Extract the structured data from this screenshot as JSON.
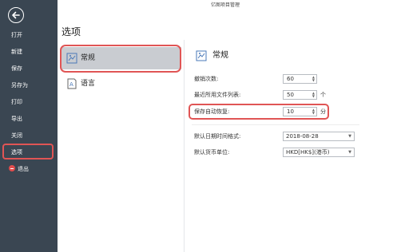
{
  "window": {
    "title": "亿图项目管理"
  },
  "sidebar": {
    "items": [
      {
        "label": "打开"
      },
      {
        "label": "新建"
      },
      {
        "label": "保存"
      },
      {
        "label": "另存为"
      },
      {
        "label": "打印"
      },
      {
        "label": "导出"
      },
      {
        "label": "关闭"
      },
      {
        "label": "选项"
      },
      {
        "label": "退出"
      }
    ]
  },
  "page_title": "选项",
  "categories": [
    {
      "label": "常规",
      "icon": "general-settings-icon"
    },
    {
      "label": "语言",
      "icon": "language-icon"
    }
  ],
  "section": {
    "title": "常规"
  },
  "settings": {
    "undo": {
      "label": "撤销次数:",
      "value": "60"
    },
    "recent": {
      "label": "最近所用文件列表:",
      "value": "50",
      "unit": "个"
    },
    "autosave": {
      "label": "保存自动恢复:",
      "value": "10",
      "unit": "分"
    },
    "date_format": {
      "label": "默认日期时间格式:",
      "value": "2018-08-28"
    },
    "currency": {
      "label": "默认货币单位:",
      "value": "HKD[HK$](港币)"
    }
  },
  "colors": {
    "sidebar": "#3a4652",
    "highlight": "#e05555",
    "selected": "#c9ccd1"
  }
}
